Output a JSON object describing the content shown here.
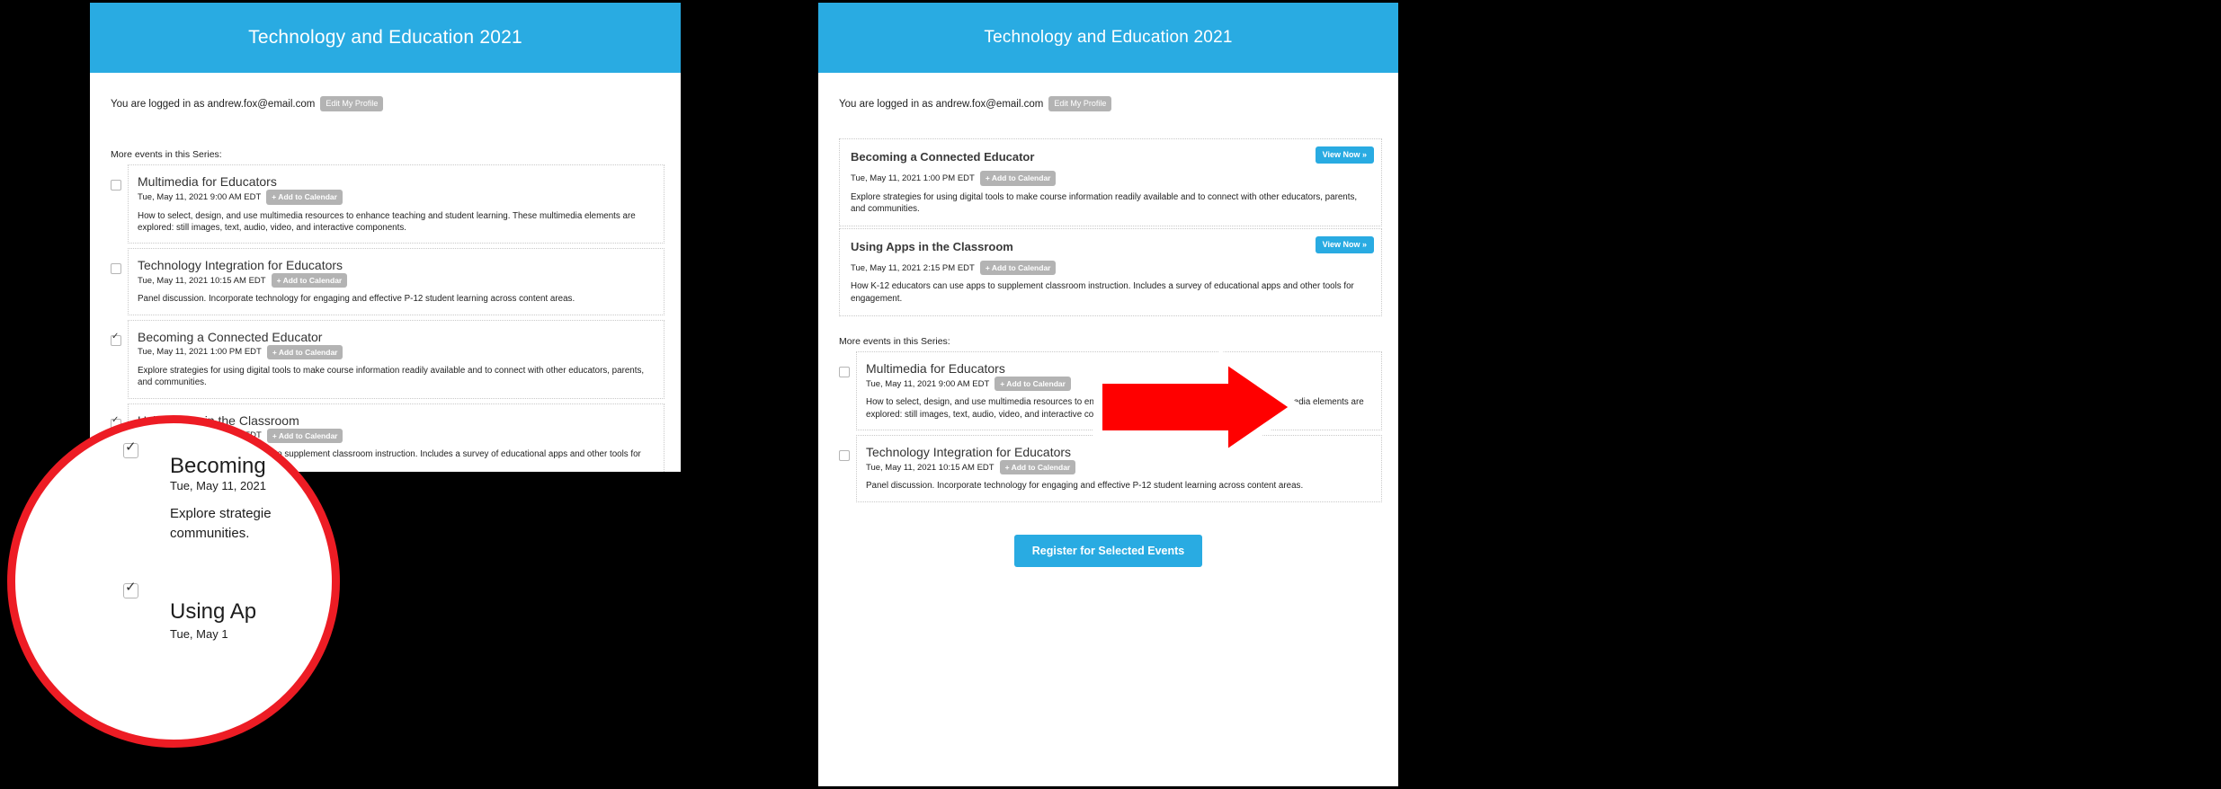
{
  "header": {
    "title": "Technology and Education 2021",
    "bg_color": "#29abe2"
  },
  "account": {
    "logged_in_text": "You are logged in as andrew.fox@email.com",
    "edit_profile_label": "Edit My Profile"
  },
  "labels": {
    "series_heading": "More events in this Series:",
    "add_to_calendar": "+ Add to Calendar",
    "view_now": "View Now »",
    "register": "Register for Selected Events"
  },
  "colors": {
    "accent": "#29abe2",
    "muted_button": "#b3b3b3",
    "annotation_red": "#ed1c24"
  },
  "events": {
    "multimedia": {
      "title": "Multimedia for Educators",
      "datetime": "Tue, May 11, 2021 9:00 AM EDT",
      "description": "How to select, design, and use multimedia resources to enhance teaching and student learning. These multimedia elements are explored: still images, text, audio, video, and interactive components."
    },
    "tech_integration": {
      "title": "Technology Integration for Educators",
      "datetime": "Tue, May 11, 2021 10:15 AM EDT",
      "description": "Panel discussion. Incorporate technology for engaging and effective P-12 student learning across content areas."
    },
    "connected_educator": {
      "title": "Becoming a Connected Educator",
      "datetime": "Tue, May 11, 2021 1:00 PM EDT",
      "description": "Explore strategies for using digital tools to make course information readily available and to connect with other educators, parents, and communities."
    },
    "using_apps": {
      "title": "Using Apps in the Classroom",
      "datetime": "Tue, May 11, 2021 2:15 PM EDT",
      "description": "How K-12 educators can use apps to supplement classroom instruction. Includes a survey of educational apps and other tools for engagement."
    }
  },
  "magnifier": {
    "becoming_title_fragment": "Becoming",
    "becoming_meta_fragment": "Tue, May 11, 2021",
    "becoming_desc_line1": "Explore strategie",
    "becoming_desc_line2": "communities.",
    "using_title_fragment": "Using Ap",
    "using_meta_fragment": "Tue, May 1"
  }
}
